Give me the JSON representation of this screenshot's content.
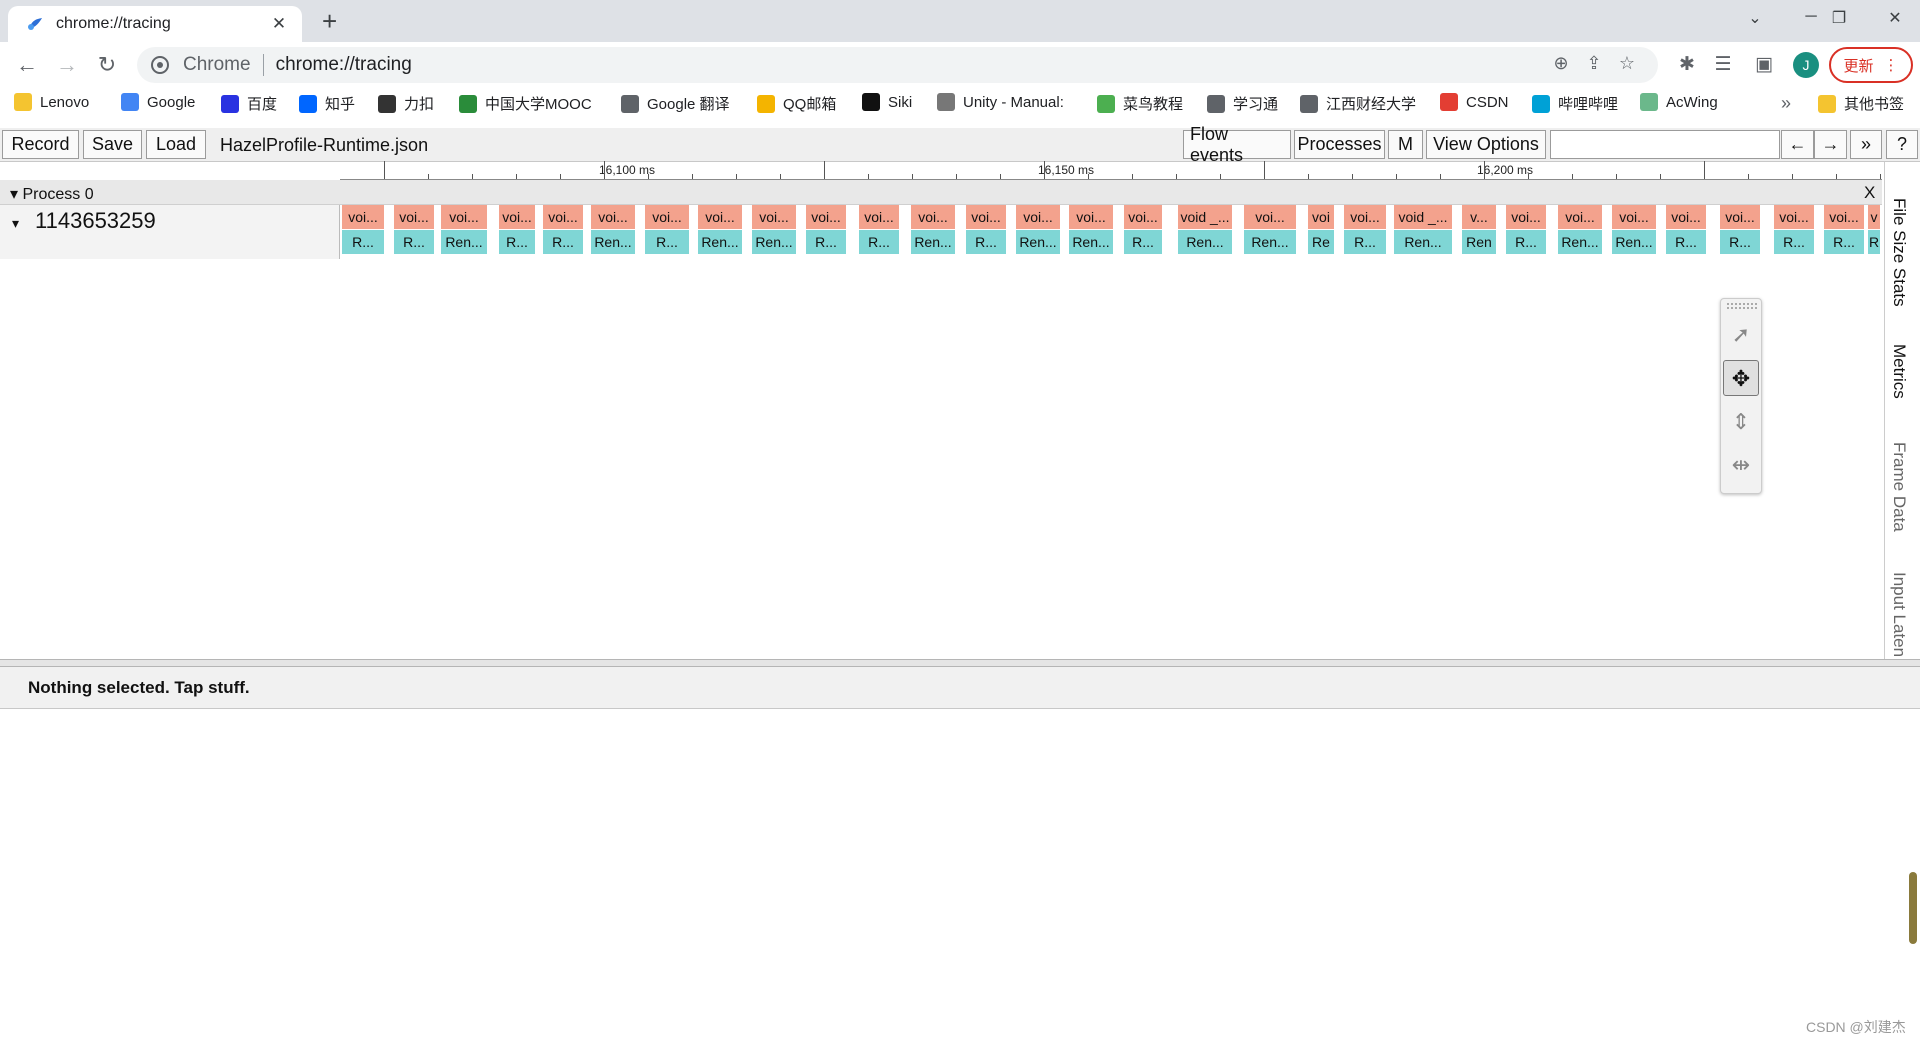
{
  "browser": {
    "tab_title": "chrome://tracing",
    "omnibox_chip": "Chrome",
    "url": "chrome://tracing",
    "avatar_letter": "J",
    "update_label": "更新"
  },
  "bookmarks": [
    {
      "label": "Lenovo",
      "icon": "folder-icon",
      "color": "#f4c430"
    },
    {
      "label": "Google",
      "icon": "google-icon",
      "color": "#4285f4"
    },
    {
      "label": "百度",
      "icon": "baidu-icon",
      "color": "#2932e1"
    },
    {
      "label": "知乎",
      "icon": "zhihu-icon",
      "color": "#0066ff"
    },
    {
      "label": "力扣",
      "icon": "leetcode-icon",
      "color": "#333333"
    },
    {
      "label": "中国大学MOOC",
      "icon": "mooc-icon",
      "color": "#2a8c3a"
    },
    {
      "label": "Google 翻译",
      "icon": "globe-icon",
      "color": "#5f6368"
    },
    {
      "label": "QQ邮箱",
      "icon": "qqmail-icon",
      "color": "#f4b400"
    },
    {
      "label": "Siki",
      "icon": "siki-icon",
      "color": "#111111"
    },
    {
      "label": "Unity - Manual:",
      "icon": "unity-icon",
      "color": "#777777"
    },
    {
      "label": "菜鸟教程",
      "icon": "runoob-icon",
      "color": "#4caf50"
    },
    {
      "label": "学习通",
      "icon": "globe-icon",
      "color": "#5f6368"
    },
    {
      "label": "江西财经大学",
      "icon": "globe-icon",
      "color": "#5f6368"
    },
    {
      "label": "CSDN",
      "icon": "csdn-icon",
      "color": "#e33e33"
    },
    {
      "label": "哔哩哔哩",
      "icon": "bilibili-icon",
      "color": "#00a1d6"
    },
    {
      "label": "AcWing",
      "icon": "acwing-icon",
      "color": "#6bb88b"
    }
  ],
  "bookmarks_overflow": "»",
  "bookmarks_other": "其他书签",
  "tracing": {
    "buttons": {
      "record": "Record",
      "save": "Save",
      "load": "Load"
    },
    "filename": "HazelProfile-Runtime.json",
    "right_buttons": {
      "flow_events": "Flow events",
      "processes": "Processes",
      "m": "M",
      "view_options": "View Options"
    },
    "nav": {
      "back": "←",
      "forward": "→",
      "more": "»",
      "help": "?"
    },
    "ruler_labels": [
      "16,100 ms",
      "16,150 ms",
      "16,200 ms"
    ],
    "process_title": "Process 0",
    "process_close": "X",
    "thread_name": "1143653259",
    "slices_top": [
      "voi...",
      "voi...",
      "voi...",
      "voi...",
      "voi...",
      "voi...",
      "voi...",
      "voi...",
      "voi...",
      "voi...",
      "voi...",
      "voi...",
      "voi...",
      "voi...",
      "voi...",
      "voi...",
      "void _...",
      "voi...",
      "voi",
      "voi...",
      "void _...",
      "v...",
      "voi...",
      "voi...",
      "voi...",
      "voi...",
      "voi...",
      "voi...",
      "voi...",
      "v"
    ],
    "slices_bottom": [
      "R...",
      "R...",
      "Ren...",
      "R...",
      "R...",
      "Ren...",
      "R...",
      "Ren...",
      "Ren...",
      "R...",
      "R...",
      "Ren...",
      "R...",
      "Ren...",
      "Ren...",
      "R...",
      "Ren...",
      "Ren...",
      "Re",
      "R...",
      "Ren...",
      "Ren",
      "R...",
      "Ren...",
      "Ren...",
      "R...",
      "R...",
      "R...",
      "R...",
      "R"
    ],
    "side_tabs": [
      "File Size Stats",
      "Metrics",
      "Frame Data",
      "Input Laten"
    ],
    "analysis_text": "Nothing selected. Tap stuff."
  },
  "watermark": "CSDN @刘建杰"
}
